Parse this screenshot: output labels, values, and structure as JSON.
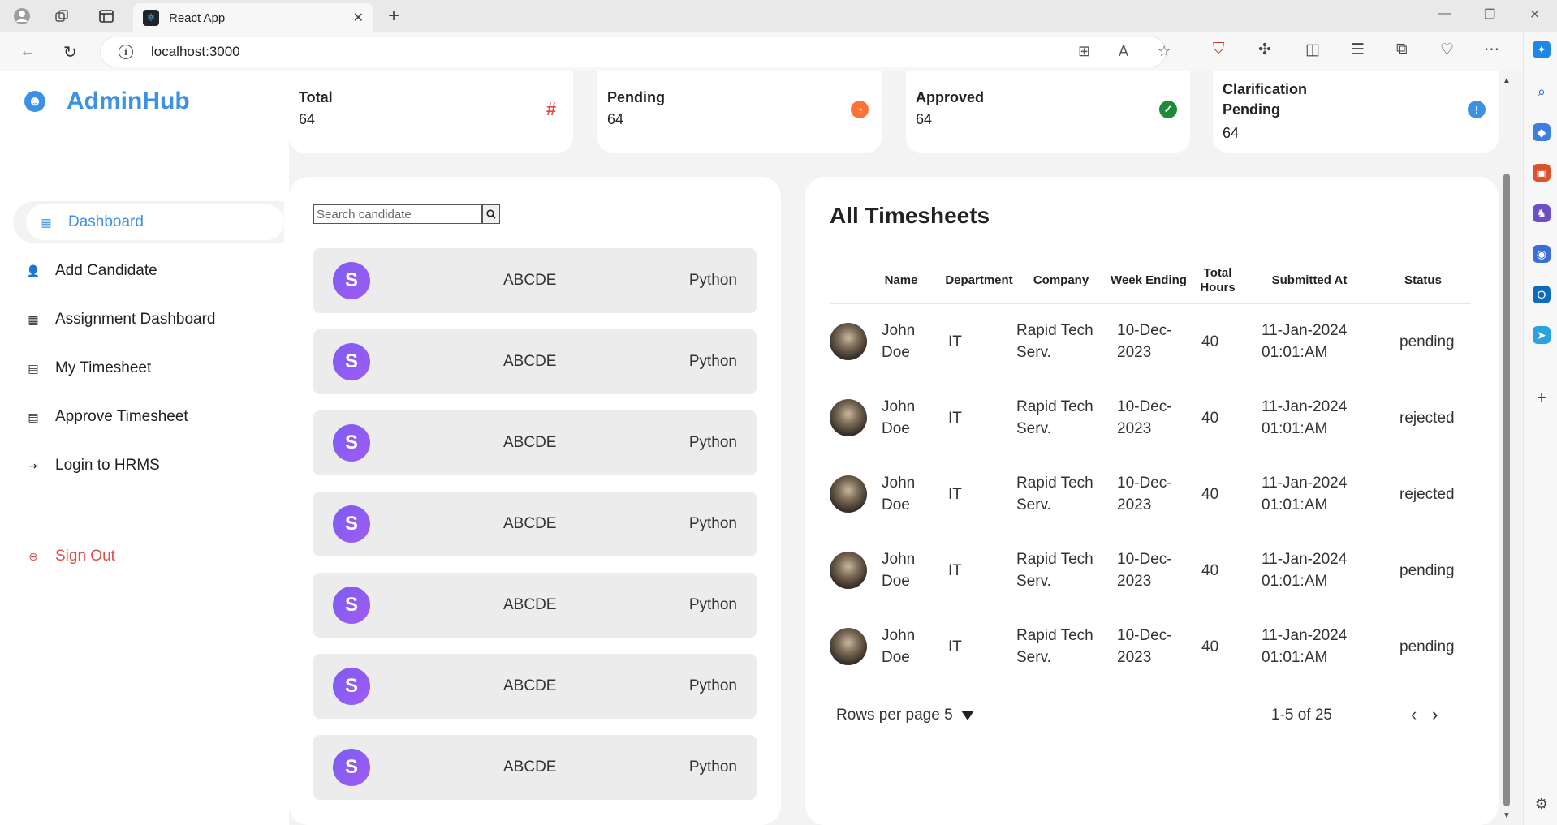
{
  "browser": {
    "tab_title": "React App",
    "tab_close": "✕",
    "new_tab": "+",
    "url": "localhost:3000"
  },
  "sidebar": {
    "brand": "AdminHub",
    "items": [
      {
        "label": "Dashboard",
        "icon": "grid-icon"
      },
      {
        "label": "Add Candidate",
        "icon": "user-plus-icon"
      },
      {
        "label": "Assignment Dashboard",
        "icon": "grid-icon"
      },
      {
        "label": "My Timesheet",
        "icon": "file-icon"
      },
      {
        "label": "Approve Timesheet",
        "icon": "file-text-icon"
      },
      {
        "label": "Login to HRMS",
        "icon": "login-icon"
      }
    ],
    "signout": "Sign Out"
  },
  "stats": [
    {
      "label": "Total",
      "value": "64",
      "icon": "hash-icon",
      "color": "#db504a"
    },
    {
      "label": "Pending",
      "value": "64",
      "icon": "clock-icon",
      "color": "#fd7238"
    },
    {
      "label": "Approved",
      "value": "64",
      "icon": "check-icon",
      "color": "#1e8a3a"
    },
    {
      "label": "Clarification Pending",
      "value": "64",
      "icon": "info-icon",
      "color": "#3c91e6"
    }
  ],
  "candidates": {
    "search_placeholder": "Search candidate",
    "rows": [
      {
        "initial": "S",
        "name": "ABCDE",
        "skill": "Python"
      },
      {
        "initial": "S",
        "name": "ABCDE",
        "skill": "Python"
      },
      {
        "initial": "S",
        "name": "ABCDE",
        "skill": "Python"
      },
      {
        "initial": "S",
        "name": "ABCDE",
        "skill": "Python"
      },
      {
        "initial": "S",
        "name": "ABCDE",
        "skill": "Python"
      },
      {
        "initial": "S",
        "name": "ABCDE",
        "skill": "Python"
      },
      {
        "initial": "S",
        "name": "ABCDE",
        "skill": "Python"
      }
    ]
  },
  "timesheets": {
    "title": "All Timesheets",
    "columns": [
      "Name",
      "Department",
      "Company",
      "Week Ending",
      "Total Hours",
      "Submitted At",
      "Status"
    ],
    "rows": [
      {
        "name": "John Doe",
        "department": "IT",
        "company": "Rapid Tech Serv.",
        "week_ending": "10-Dec-2023",
        "hours": "40",
        "submitted": "11-Jan-2024 01:01:AM",
        "status": "pending"
      },
      {
        "name": "John Doe",
        "department": "IT",
        "company": "Rapid Tech Serv.",
        "week_ending": "10-Dec-2023",
        "hours": "40",
        "submitted": "11-Jan-2024 01:01:AM",
        "status": "rejected"
      },
      {
        "name": "John Doe",
        "department": "IT",
        "company": "Rapid Tech Serv.",
        "week_ending": "10-Dec-2023",
        "hours": "40",
        "submitted": "11-Jan-2024 01:01:AM",
        "status": "rejected"
      },
      {
        "name": "John Doe",
        "department": "IT",
        "company": "Rapid Tech Serv.",
        "week_ending": "10-Dec-2023",
        "hours": "40",
        "submitted": "11-Jan-2024 01:01:AM",
        "status": "pending"
      },
      {
        "name": "John Doe",
        "department": "IT",
        "company": "Rapid Tech Serv.",
        "week_ending": "10-Dec-2023",
        "hours": "40",
        "submitted": "11-Jan-2024 01:01:AM",
        "status": "pending"
      }
    ],
    "pager": {
      "rows_label": "Rows per page",
      "rows_value": "5",
      "range": "1-5 of 25"
    }
  },
  "colors": {
    "accent": "#3c91e6",
    "danger": "#db504a"
  }
}
